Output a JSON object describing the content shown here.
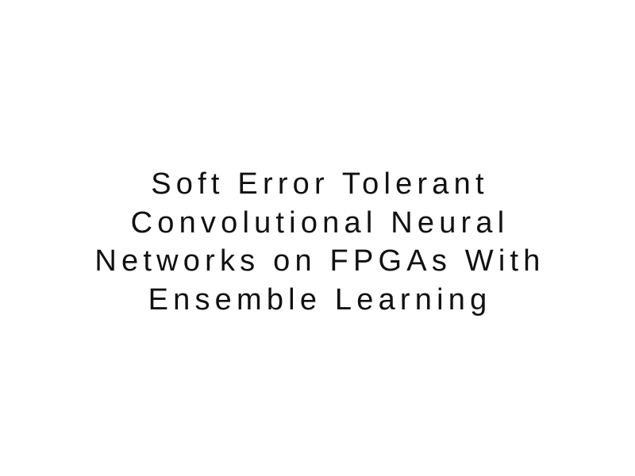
{
  "document": {
    "title_lines": [
      "Soft Error Tolerant",
      "Convolutional Neural",
      "Networks on FPGAs With",
      "Ensemble Learning"
    ]
  }
}
